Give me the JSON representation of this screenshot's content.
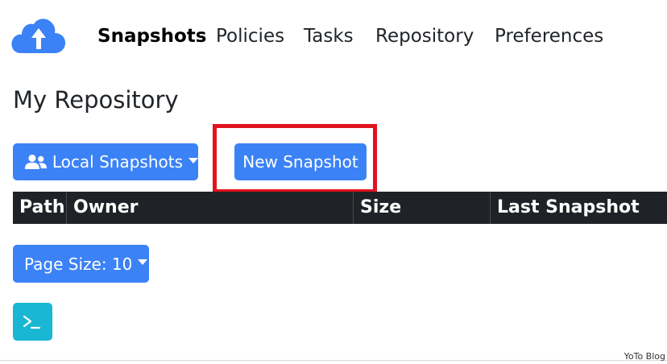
{
  "nav": {
    "logo_icon": "cloud-upload-icon",
    "items": [
      {
        "label": "Snapshots",
        "active": true
      },
      {
        "label": "Policies",
        "active": false
      },
      {
        "label": "Tasks",
        "active": false
      },
      {
        "label": "Repository",
        "active": false
      },
      {
        "label": "Preferences",
        "active": false
      }
    ]
  },
  "page": {
    "title": "My Repository"
  },
  "toolbar": {
    "local_snapshots_label": "Local Snapshots",
    "local_snapshots_icon": "users-icon",
    "new_snapshot_label": "New Snapshot",
    "highlight_color": "#e0141e"
  },
  "table": {
    "columns": [
      "Path",
      "Owner",
      "Size",
      "Last Snapshot"
    ],
    "rows": []
  },
  "pagination": {
    "page_size_label": "Page Size: 10"
  },
  "terminal": {
    "icon": "terminal-icon"
  },
  "watermark": "YoTo Blog",
  "colors": {
    "primary": "#3b82f6",
    "table_header": "#1f2226",
    "info": "#19b7d3"
  }
}
